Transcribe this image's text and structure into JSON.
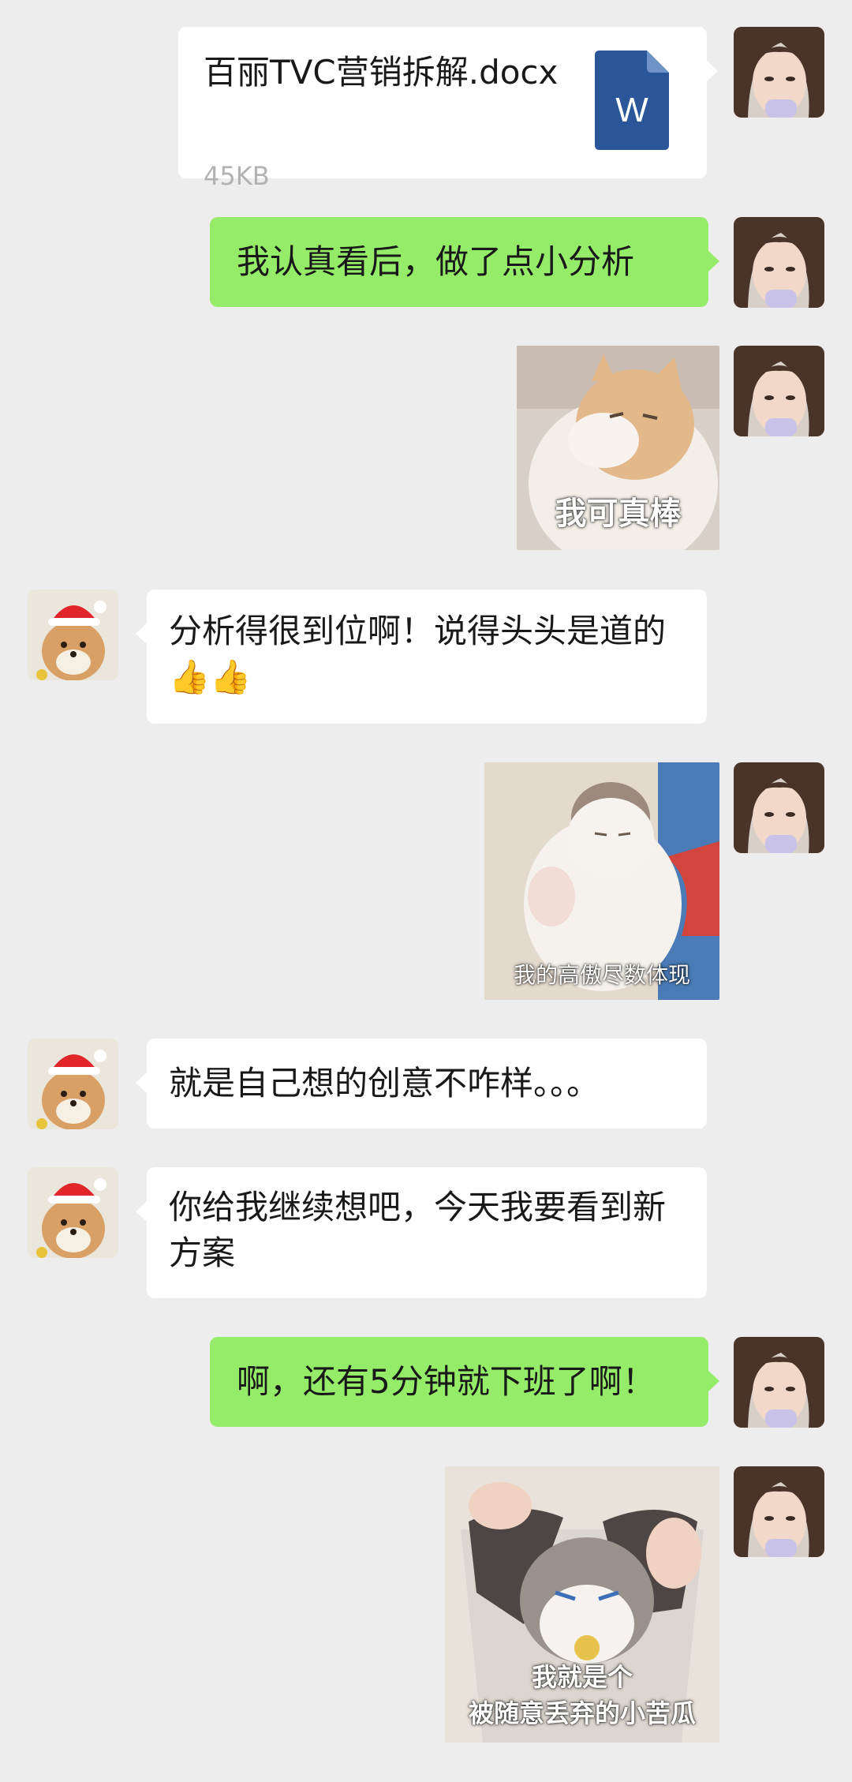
{
  "messages": {
    "file": {
      "name": "百丽TVC营销拆解.docx",
      "size": "45KB",
      "icon_letter": "W",
      "icon_color": "#2b579a"
    },
    "m1": "我认真看后，做了点小分析",
    "sticker1_caption": "我可真棒",
    "m2": "分析得很到位啊！说得头头是道的",
    "m2_emoji": "👍👍",
    "sticker2_caption": "我的高傲尽数体现",
    "m3": "就是自己想的创意不咋样。。。",
    "m4": "你给我继续想吧，今天我要看到新方案",
    "m5": "啊，还有5分钟就下班了啊！",
    "sticker3_caption_line1": "我就是个",
    "sticker3_caption_line2": "被随意丢弃的小苦瓜"
  },
  "colors": {
    "background": "#ededed",
    "self_bubble": "#95ec69",
    "other_bubble": "#ffffff"
  }
}
